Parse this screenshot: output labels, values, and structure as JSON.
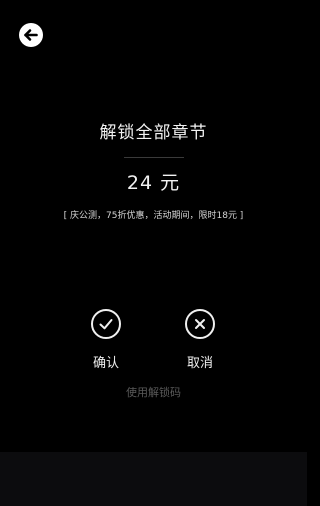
{
  "header": {
    "back_icon": "arrow-left-icon"
  },
  "dialog": {
    "title": "解锁全部章节",
    "price": "24 元",
    "promo": "[ 庆公测，75折优惠，活动期间，限时18元 ]"
  },
  "actions": {
    "confirm_label": "确认",
    "confirm_icon": "check-circle-icon",
    "cancel_label": "取消",
    "cancel_icon": "close-circle-icon",
    "unlock_code_label": "使用解锁码"
  },
  "colors": {
    "background": "#000000",
    "text": "#f2f2f2",
    "muted_link": "#5a5a5a"
  }
}
